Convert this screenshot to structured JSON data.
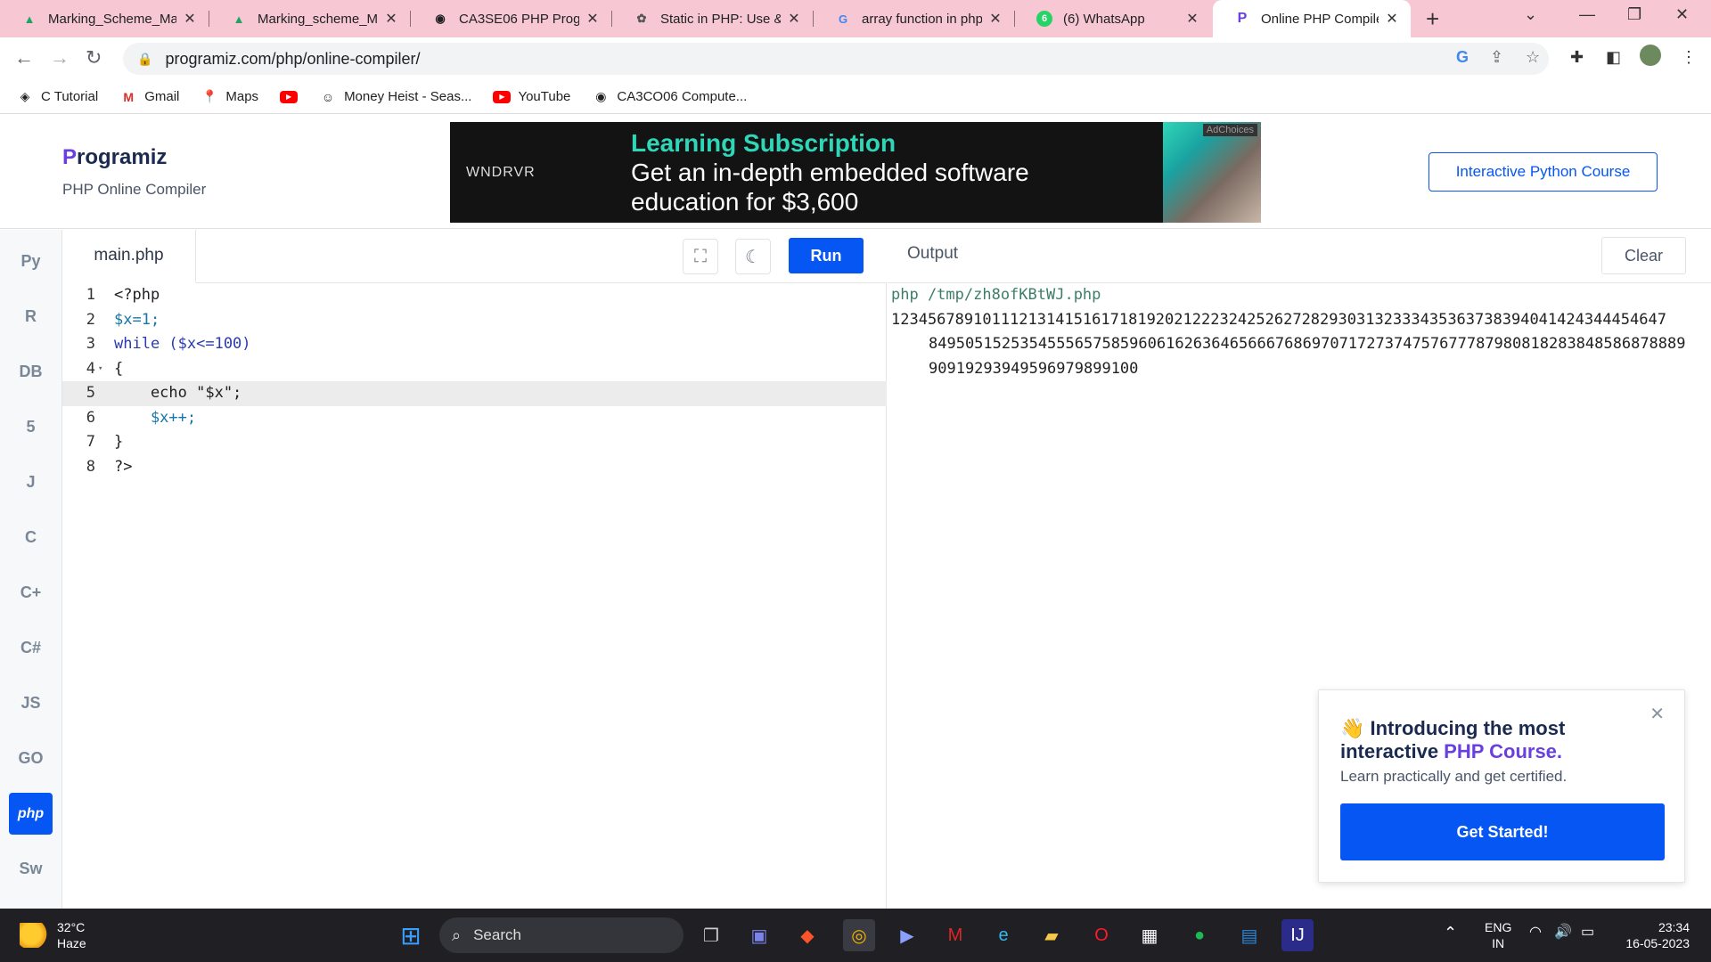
{
  "browser": {
    "tabs": [
      {
        "title": "Marking_Scheme_May",
        "icon": "google-drive-icon"
      },
      {
        "title": "Marking_scheme_May",
        "icon": "google-drive-icon"
      },
      {
        "title": "CA3SE06 PHP Program",
        "icon": "globe-icon"
      },
      {
        "title": "Static in PHP: Use & E",
        "icon": "openai-icon"
      },
      {
        "title": "array function in php",
        "icon": "google-icon"
      },
      {
        "title": "(6) WhatsApp",
        "icon": "whatsapp-icon"
      },
      {
        "title": "Online PHP Compiler",
        "icon": "programiz-icon",
        "active": true
      }
    ],
    "url": "programiz.com/php/online-compiler/",
    "bookmarks": [
      {
        "label": "C Tutorial",
        "icon": "c-tutorial-icon"
      },
      {
        "label": "Gmail",
        "icon": "gmail-icon"
      },
      {
        "label": "Maps",
        "icon": "maps-icon"
      },
      {
        "label": "",
        "icon": "youtube-icon"
      },
      {
        "label": "Money Heist - Seas...",
        "icon": "money-heist-icon"
      },
      {
        "label": "YouTube",
        "icon": "youtube-icon"
      },
      {
        "label": "CA3CO06 Compute...",
        "icon": "globe-icon"
      }
    ]
  },
  "site": {
    "logo": "rogramiz",
    "logo_initial": "P",
    "subtitle": "PHP Online Compiler",
    "course_button": "Interactive Python Course",
    "ad": {
      "brand": "WNDRVR",
      "headline": "Learning Subscription",
      "body": "Get an in-depth embedded software education for $3,600",
      "choices": "AdChoices"
    }
  },
  "languages": [
    {
      "name": "python-icon",
      "glyph": "Py"
    },
    {
      "name": "r-icon",
      "glyph": "R"
    },
    {
      "name": "sql-icon",
      "glyph": "DB"
    },
    {
      "name": "html5-icon",
      "glyph": "5"
    },
    {
      "name": "java-icon",
      "glyph": "J"
    },
    {
      "name": "c-icon",
      "glyph": "C"
    },
    {
      "name": "cpp-icon",
      "glyph": "C+"
    },
    {
      "name": "csharp-icon",
      "glyph": "C#"
    },
    {
      "name": "javascript-icon",
      "glyph": "JS"
    },
    {
      "name": "go-icon",
      "glyph": "GO"
    },
    {
      "name": "php-icon",
      "glyph": "php",
      "active": true
    },
    {
      "name": "swift-icon",
      "glyph": "Sw"
    }
  ],
  "editor": {
    "filename": "main.php",
    "run_label": "Run",
    "lines": [
      {
        "num": "1",
        "code": "<?php"
      },
      {
        "num": "2",
        "code": "$x=1;"
      },
      {
        "num": "3",
        "code": "while ($x<=100)"
      },
      {
        "num": "4",
        "code": "{"
      },
      {
        "num": "5",
        "code": "    echo \"$x\";"
      },
      {
        "num": "6",
        "code": "    $x++;"
      },
      {
        "num": "7",
        "code": "}"
      },
      {
        "num": "8",
        "code": "?>"
      }
    ]
  },
  "output": {
    "title": "Output",
    "clear_label": "Clear",
    "command": "php /tmp/zh8ofKBtWJ.php",
    "result_lines": [
      "1234567891011121314151617181920212223242526272829303132333435363738394041424344454647",
      "84950515253545556575859606162636465666768697071727374757677787980818283848586878889",
      "90919293949596979899100"
    ]
  },
  "promo": {
    "title_a": "👋 Introducing the most interactive ",
    "title_b": "PHP Course.",
    "subtitle": "Learn practically and get certified.",
    "button": "Get Started!"
  },
  "taskbar": {
    "temperature": "32°C",
    "weather": "Haze",
    "search": "Search",
    "lang_a": "ENG",
    "lang_b": "IN",
    "time": "23:34",
    "date": "16-05-2023"
  }
}
